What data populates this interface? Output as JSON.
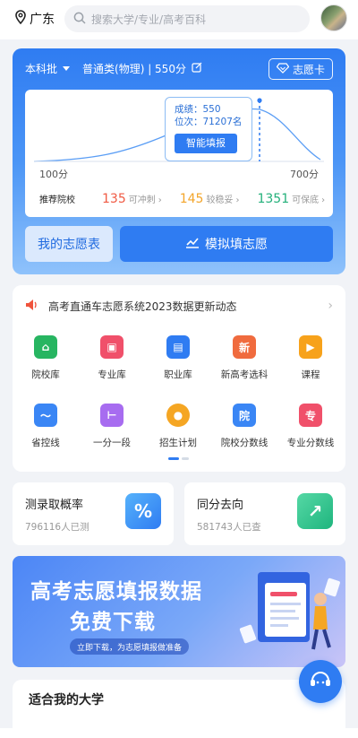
{
  "header": {
    "location": "广东",
    "search_placeholder": "搜索大学/专业/高考百科"
  },
  "score_card": {
    "batch": "本科批",
    "profile": "普通类(物理) | 550分",
    "card_button": "志愿卡",
    "tooltip_score": "成绩：550",
    "tooltip_rank": "位次：71207名",
    "tooltip_button": "智能填报",
    "axis_min": "100分",
    "axis_max": "700分",
    "recommend_label": "推荐院校",
    "chong_count": "135",
    "chong_label": "可冲刺",
    "wen_count": "145",
    "wen_label": "较稳妥",
    "bao_count": "1351",
    "bao_label": "可保底",
    "my_button": "我的志愿表",
    "simulate_button": "模拟填志愿"
  },
  "notice": {
    "text": "高考直通车志愿系统2023数据更新动态"
  },
  "grid": [
    {
      "label": "院校库",
      "icon": "school-icon",
      "color": "#27b561"
    },
    {
      "label": "专业库",
      "icon": "major-icon",
      "color": "#f0506a"
    },
    {
      "label": "职业库",
      "icon": "briefcase-icon",
      "color": "#2f7cf2"
    },
    {
      "label": "新高考选科",
      "icon": "new-gaokao-icon",
      "color": "#f06b3e"
    },
    {
      "label": "课程",
      "icon": "play-icon",
      "color": "#f7a21b"
    },
    {
      "label": "省控线",
      "icon": "line-chart-icon",
      "color": "#3a86f5"
    },
    {
      "label": "一分一段",
      "icon": "segment-icon",
      "color": "#a76cf0"
    },
    {
      "label": "招生计划",
      "icon": "plan-icon",
      "color": "#f5a623"
    },
    {
      "label": "院校分数线",
      "icon": "school-score-icon",
      "color": "#3a86f5"
    },
    {
      "label": "专业分数线",
      "icon": "major-score-icon",
      "color": "#f0506a"
    }
  ],
  "stats": {
    "prob_title": "测录取概率",
    "prob_sub": "796116人已测",
    "same_title": "同分去向",
    "same_sub": "581743人已查"
  },
  "banner": {
    "line1": "高考志愿填报数据",
    "line2": "免费下载",
    "caption": "立即下载，为志愿填报做准备"
  },
  "suitable": {
    "title": "适合我的大学"
  }
}
